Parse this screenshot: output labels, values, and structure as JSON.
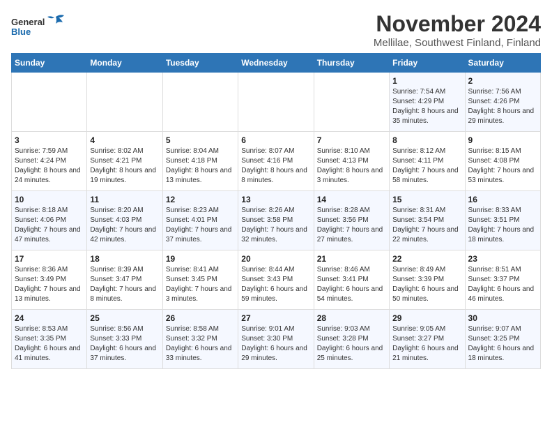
{
  "header": {
    "logo_general": "General",
    "logo_blue": "Blue",
    "title": "November 2024",
    "subtitle": "Mellilae, Southwest Finland, Finland"
  },
  "days_of_week": [
    "Sunday",
    "Monday",
    "Tuesday",
    "Wednesday",
    "Thursday",
    "Friday",
    "Saturday"
  ],
  "weeks": [
    [
      {
        "day": "",
        "content": ""
      },
      {
        "day": "",
        "content": ""
      },
      {
        "day": "",
        "content": ""
      },
      {
        "day": "",
        "content": ""
      },
      {
        "day": "",
        "content": ""
      },
      {
        "day": "1",
        "content": "Sunrise: 7:54 AM\nSunset: 4:29 PM\nDaylight: 8 hours and 35 minutes."
      },
      {
        "day": "2",
        "content": "Sunrise: 7:56 AM\nSunset: 4:26 PM\nDaylight: 8 hours and 29 minutes."
      }
    ],
    [
      {
        "day": "3",
        "content": "Sunrise: 7:59 AM\nSunset: 4:24 PM\nDaylight: 8 hours and 24 minutes."
      },
      {
        "day": "4",
        "content": "Sunrise: 8:02 AM\nSunset: 4:21 PM\nDaylight: 8 hours and 19 minutes."
      },
      {
        "day": "5",
        "content": "Sunrise: 8:04 AM\nSunset: 4:18 PM\nDaylight: 8 hours and 13 minutes."
      },
      {
        "day": "6",
        "content": "Sunrise: 8:07 AM\nSunset: 4:16 PM\nDaylight: 8 hours and 8 minutes."
      },
      {
        "day": "7",
        "content": "Sunrise: 8:10 AM\nSunset: 4:13 PM\nDaylight: 8 hours and 3 minutes."
      },
      {
        "day": "8",
        "content": "Sunrise: 8:12 AM\nSunset: 4:11 PM\nDaylight: 7 hours and 58 minutes."
      },
      {
        "day": "9",
        "content": "Sunrise: 8:15 AM\nSunset: 4:08 PM\nDaylight: 7 hours and 53 minutes."
      }
    ],
    [
      {
        "day": "10",
        "content": "Sunrise: 8:18 AM\nSunset: 4:06 PM\nDaylight: 7 hours and 47 minutes."
      },
      {
        "day": "11",
        "content": "Sunrise: 8:20 AM\nSunset: 4:03 PM\nDaylight: 7 hours and 42 minutes."
      },
      {
        "day": "12",
        "content": "Sunrise: 8:23 AM\nSunset: 4:01 PM\nDaylight: 7 hours and 37 minutes."
      },
      {
        "day": "13",
        "content": "Sunrise: 8:26 AM\nSunset: 3:58 PM\nDaylight: 7 hours and 32 minutes."
      },
      {
        "day": "14",
        "content": "Sunrise: 8:28 AM\nSunset: 3:56 PM\nDaylight: 7 hours and 27 minutes."
      },
      {
        "day": "15",
        "content": "Sunrise: 8:31 AM\nSunset: 3:54 PM\nDaylight: 7 hours and 22 minutes."
      },
      {
        "day": "16",
        "content": "Sunrise: 8:33 AM\nSunset: 3:51 PM\nDaylight: 7 hours and 18 minutes."
      }
    ],
    [
      {
        "day": "17",
        "content": "Sunrise: 8:36 AM\nSunset: 3:49 PM\nDaylight: 7 hours and 13 minutes."
      },
      {
        "day": "18",
        "content": "Sunrise: 8:39 AM\nSunset: 3:47 PM\nDaylight: 7 hours and 8 minutes."
      },
      {
        "day": "19",
        "content": "Sunrise: 8:41 AM\nSunset: 3:45 PM\nDaylight: 7 hours and 3 minutes."
      },
      {
        "day": "20",
        "content": "Sunrise: 8:44 AM\nSunset: 3:43 PM\nDaylight: 6 hours and 59 minutes."
      },
      {
        "day": "21",
        "content": "Sunrise: 8:46 AM\nSunset: 3:41 PM\nDaylight: 6 hours and 54 minutes."
      },
      {
        "day": "22",
        "content": "Sunrise: 8:49 AM\nSunset: 3:39 PM\nDaylight: 6 hours and 50 minutes."
      },
      {
        "day": "23",
        "content": "Sunrise: 8:51 AM\nSunset: 3:37 PM\nDaylight: 6 hours and 46 minutes."
      }
    ],
    [
      {
        "day": "24",
        "content": "Sunrise: 8:53 AM\nSunset: 3:35 PM\nDaylight: 6 hours and 41 minutes."
      },
      {
        "day": "25",
        "content": "Sunrise: 8:56 AM\nSunset: 3:33 PM\nDaylight: 6 hours and 37 minutes."
      },
      {
        "day": "26",
        "content": "Sunrise: 8:58 AM\nSunset: 3:32 PM\nDaylight: 6 hours and 33 minutes."
      },
      {
        "day": "27",
        "content": "Sunrise: 9:01 AM\nSunset: 3:30 PM\nDaylight: 6 hours and 29 minutes."
      },
      {
        "day": "28",
        "content": "Sunrise: 9:03 AM\nSunset: 3:28 PM\nDaylight: 6 hours and 25 minutes."
      },
      {
        "day": "29",
        "content": "Sunrise: 9:05 AM\nSunset: 3:27 PM\nDaylight: 6 hours and 21 minutes."
      },
      {
        "day": "30",
        "content": "Sunrise: 9:07 AM\nSunset: 3:25 PM\nDaylight: 6 hours and 18 minutes."
      }
    ]
  ]
}
